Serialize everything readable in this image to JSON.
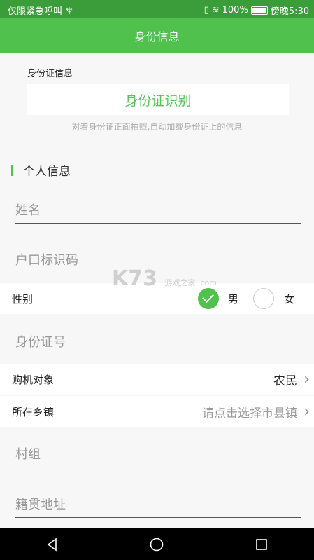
{
  "status_bar": {
    "left_text": "仅限紧急呼叫 ♆",
    "battery": "100%",
    "time": "傍晚5:30"
  },
  "header": {
    "title": "身份信息"
  },
  "id_card": {
    "section_label": "身份证信息",
    "button_label": "身份证识别",
    "hint": "对着身份证正面拍照,自动加载身份证上的信息"
  },
  "personal": {
    "section_title": "个人信息",
    "name_placeholder": "姓名",
    "hukou_placeholder": "户口标识码",
    "gender_label": "性别",
    "gender_male": "男",
    "gender_female": "女",
    "id_number_placeholder": "身份证号",
    "buyer_label": "购机对象",
    "buyer_value": "农民",
    "town_label": "所在乡镇",
    "town_value": "请点击选择市县镇",
    "village_placeholder": "村组",
    "native_placeholder": "籍贯地址"
  },
  "watermark": {
    "main": "K73",
    "sub": "游戏之家 .com"
  },
  "colors": {
    "status_bar": "#3b9d3a",
    "title_bar": "#4fc14c",
    "accent": "#4fc14c"
  }
}
